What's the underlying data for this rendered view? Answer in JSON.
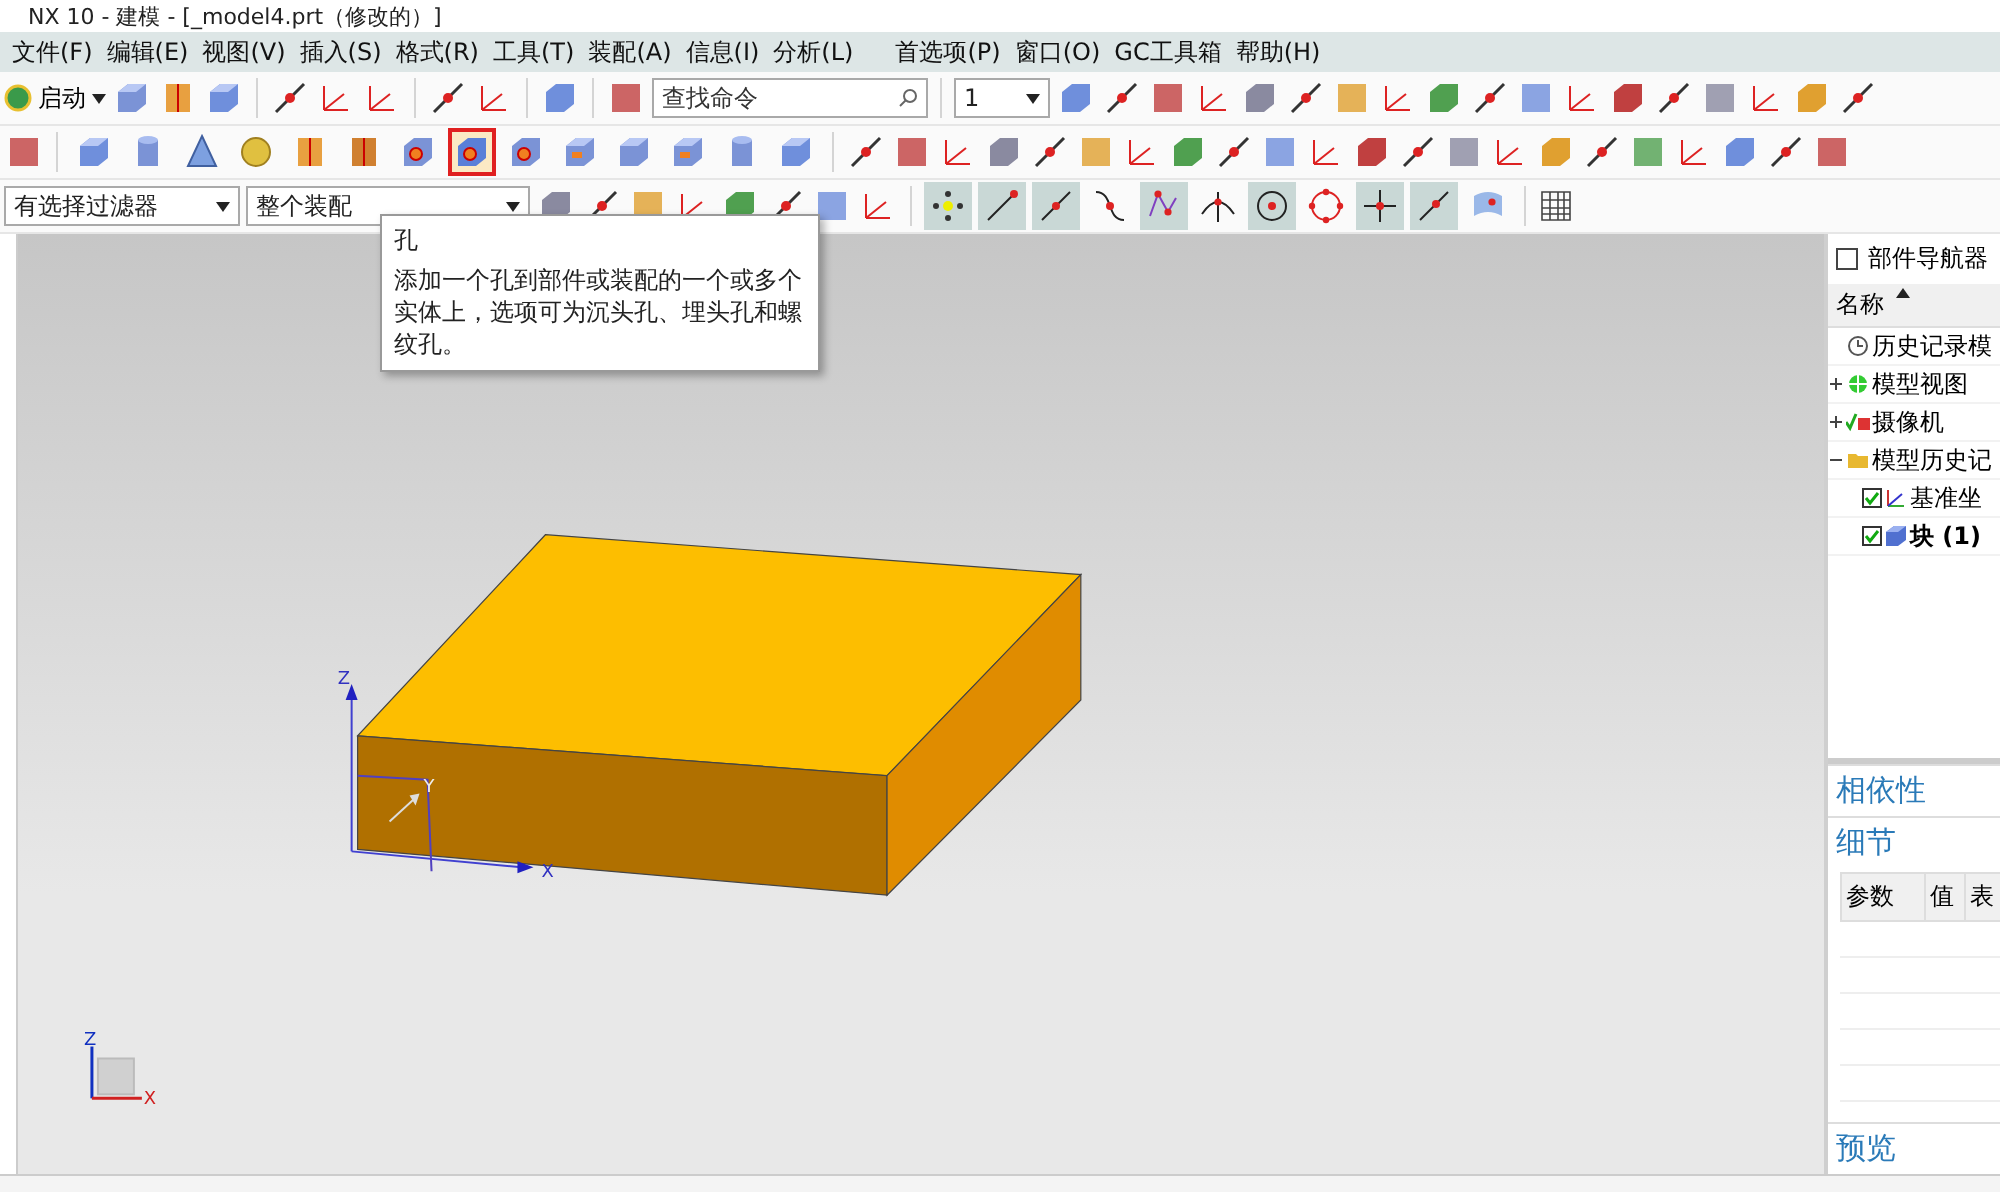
{
  "window": {
    "title": "NX 10 - 建模 - [_model4.prt（修改的）]"
  },
  "menu": [
    "文件(F)",
    "编辑(E)",
    "视图(V)",
    "插入(S)",
    "格式(R)",
    "工具(T)",
    "装配(A)",
    "信息(I)",
    "分析(L)",
    "首选项(P)",
    "窗口(O)",
    "GC工具箱",
    "帮助(H)"
  ],
  "toolbar": {
    "start_label": "启动",
    "search": {
      "placeholder": "查找命令"
    },
    "layer": {
      "value": "1"
    }
  },
  "feature_tools": [
    {
      "kind": "cube",
      "selected": false
    },
    {
      "kind": "cylinder",
      "selected": false
    },
    {
      "kind": "cone",
      "selected": false
    },
    {
      "kind": "sphere",
      "selected": false
    },
    {
      "kind": "extrude",
      "selected": false
    },
    {
      "kind": "revolve",
      "selected": false
    },
    {
      "kind": "boss",
      "selected": false
    },
    {
      "kind": "hole",
      "selected": true
    },
    {
      "kind": "boss",
      "selected": false
    },
    {
      "kind": "pocket",
      "selected": false
    },
    {
      "kind": "pad",
      "selected": false
    },
    {
      "kind": "slot",
      "selected": false
    },
    {
      "kind": "cylinder",
      "selected": false
    },
    {
      "kind": "cube",
      "selected": false
    }
  ],
  "selection_bar": {
    "filter": "有选择过滤器",
    "scope": "整个装配"
  },
  "snap_tools": [
    {
      "kind": "point",
      "on": true
    },
    {
      "kind": "end",
      "on": true
    },
    {
      "kind": "mid",
      "on": true
    },
    {
      "kind": "curve",
      "on": false
    },
    {
      "kind": "control",
      "on": true
    },
    {
      "kind": "intersect",
      "on": false
    },
    {
      "kind": "center",
      "on": true
    },
    {
      "kind": "quadrant",
      "on": false
    },
    {
      "kind": "cross",
      "on": true
    },
    {
      "kind": "line",
      "on": true
    },
    {
      "kind": "face",
      "on": false
    }
  ],
  "tooltip": {
    "title": "孔",
    "text": "添加一个孔到部件或装配的一个或多个实体上，选项可为沉头孔、埋头孔和螺纹孔。"
  },
  "viewport": {
    "csys_labels": {
      "x": "X",
      "y": "Y",
      "z": "Z"
    },
    "triad_labels": {
      "x": "X",
      "z": "Z"
    }
  },
  "part_navigator": {
    "title": "部件导航器",
    "column": "名称",
    "tree": [
      {
        "label": "历史记录模",
        "kind": "clock"
      },
      {
        "label": "模型视图",
        "kind": "views",
        "expanded": false
      },
      {
        "label": "摄像机",
        "kind": "camera",
        "expanded": false
      },
      {
        "label": "模型历史记",
        "kind": "folder",
        "expanded": true,
        "children": [
          {
            "label": "基准坐",
            "kind": "datum",
            "checked": true,
            "selected": false
          },
          {
            "label": "块 (1)",
            "kind": "block",
            "checked": true,
            "selected": true
          }
        ]
      }
    ]
  },
  "dependencies": "相依性",
  "details": {
    "title": "细节",
    "columns": [
      "参数",
      "值",
      "表"
    ]
  },
  "preview": "预览"
}
